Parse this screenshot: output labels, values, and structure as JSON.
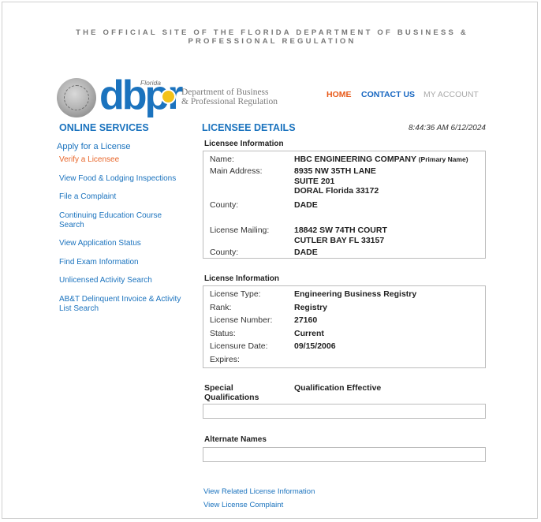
{
  "banner": {
    "line1": "THE OFFICIAL SITE OF THE FLORIDA DEPARTMENT OF BUSINESS &",
    "line2": "PROFESSIONAL REGULATION"
  },
  "logo": {
    "wordmark": "dbpr",
    "florida": "Florida",
    "dept_line1": "Department of Business",
    "dept_line2": "& Professional Regulation"
  },
  "top_nav": {
    "home": "HOME",
    "contact": "CONTACT US",
    "account": "MY ACCOUNT"
  },
  "sidebar": {
    "title": "ONLINE SERVICES",
    "items": [
      {
        "label": "Apply for a License"
      },
      {
        "label": "Verify a Licensee"
      },
      {
        "label": "View Food & Lodging Inspections"
      },
      {
        "label": "File a Complaint"
      },
      {
        "label": "Continuing Education Course Search"
      },
      {
        "label": "View Application Status"
      },
      {
        "label": "Find Exam Information"
      },
      {
        "label": "Unlicensed Activity Search"
      },
      {
        "label": "AB&T Delinquent Invoice & Activity List Search"
      }
    ]
  },
  "main": {
    "title": "LICENSEE DETAILS",
    "timestamp": "8:44:36 AM 6/12/2024",
    "licensee_info": {
      "heading": "Licensee Information",
      "name_label": "Name:",
      "name_value": "HBC ENGINEERING COMPANY",
      "name_note": "(Primary Name)",
      "address_label": "Main Address:",
      "address_line1": "8935 NW 35TH LANE",
      "address_line2": "SUITE 201",
      "address_line3": "DORAL  Florida  33172",
      "county_label": "County:",
      "county_value": "DADE",
      "mailing_label": "License Mailing:",
      "mailing_line1": "18842 SW 74TH COURT",
      "mailing_line2": "CUTLER BAY  FL   33157",
      "county2_label": "County:",
      "county2_value": "DADE"
    },
    "license_info": {
      "heading": "License Information",
      "type_label": "License Type:",
      "type_value": "Engineering Business Registry",
      "rank_label": "Rank:",
      "rank_value": "Registry",
      "number_label": "License Number:",
      "number_value": "27160",
      "status_label": "Status:",
      "status_value": "Current",
      "date_label": "Licensure Date:",
      "date_value": "09/15/2006",
      "expires_label": "Expires:"
    },
    "special": {
      "label": "Special Qualifications",
      "effective": "Qualification Effective"
    },
    "alternate": {
      "heading": "Alternate Names"
    },
    "links": {
      "related": "View Related License Information",
      "complaint": "View License Complaint"
    }
  },
  "colors": {
    "link_blue": "#1b73be",
    "home_orange": "#e85a1a",
    "active_orange": "#e8662a",
    "muted_gray": "#aaaaaa"
  }
}
